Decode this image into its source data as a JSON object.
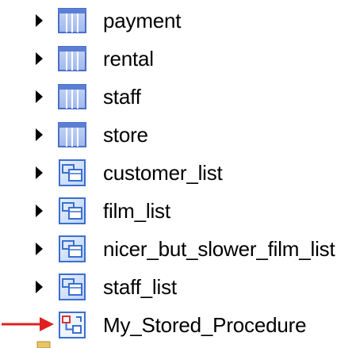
{
  "tree": {
    "tables": [
      {
        "label": "payment",
        "icon": "table-icon"
      },
      {
        "label": "rental",
        "icon": "table-icon"
      },
      {
        "label": "staff",
        "icon": "table-icon"
      },
      {
        "label": "store",
        "icon": "table-icon"
      }
    ],
    "views": [
      {
        "label": "customer_list",
        "icon": "view-icon"
      },
      {
        "label": "film_list",
        "icon": "view-icon"
      },
      {
        "label": "nicer_but_slower_film_list",
        "icon": "view-icon"
      },
      {
        "label": "staff_list",
        "icon": "view-icon"
      }
    ],
    "procedure": {
      "label": "My_Stored_Procedure",
      "icon": "stored-procedure-icon"
    }
  },
  "colors": {
    "arrow": "#e02020",
    "table_blue": "#5b7fd4",
    "view_blue": "#3a6fd0"
  }
}
